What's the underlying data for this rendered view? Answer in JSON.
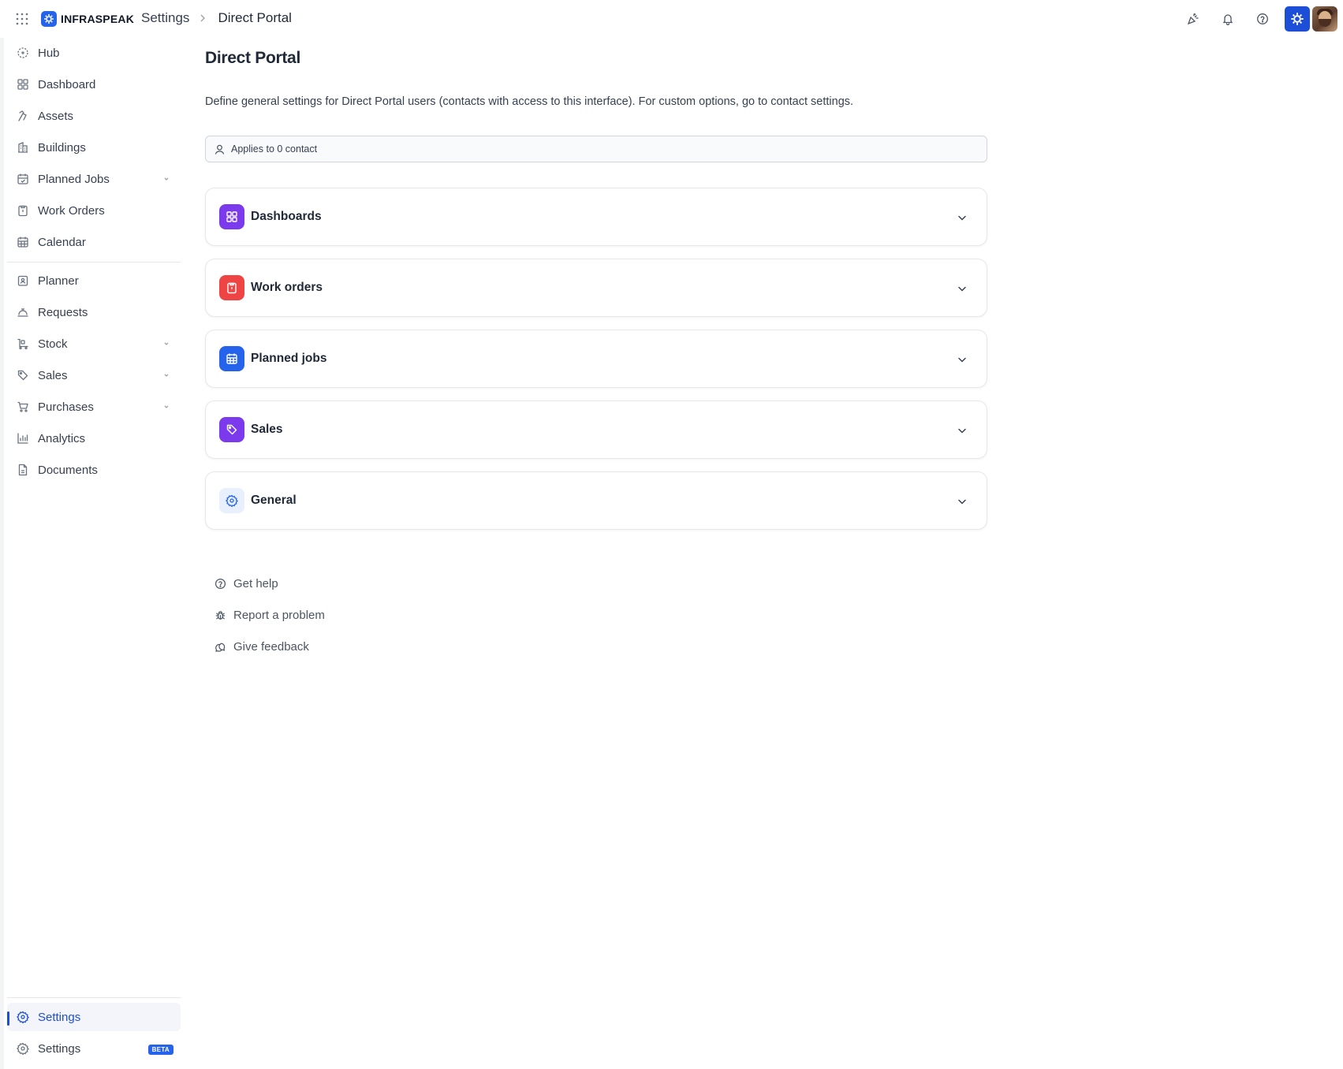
{
  "brand": {
    "name": "INFRASPEAK",
    "accent": "#2563eb"
  },
  "breadcrumb": {
    "parent": "Settings",
    "current": "Direct Portal"
  },
  "topbar": {
    "icons": [
      "apps-grid-icon",
      "celebrate-icon",
      "bell-icon",
      "help-circle-icon",
      "org-logo-icon",
      "avatar"
    ]
  },
  "sidebar": {
    "items": [
      {
        "label": "Hub",
        "icon": "hub-icon"
      },
      {
        "label": "Dashboard",
        "icon": "dashboard-icon"
      },
      {
        "label": "Assets",
        "icon": "assets-icon"
      },
      {
        "label": "Buildings",
        "icon": "buildings-icon"
      },
      {
        "label": "Planned Jobs",
        "icon": "calendar-check-icon",
        "expandable": true
      },
      {
        "label": "Work Orders",
        "icon": "clipboard-icon"
      },
      {
        "label": "Calendar",
        "icon": "calendar-icon"
      },
      {
        "label": "Planner",
        "icon": "planner-icon"
      },
      {
        "label": "Requests",
        "icon": "bell-service-icon"
      },
      {
        "label": "Stock",
        "icon": "stock-icon",
        "expandable": true
      },
      {
        "label": "Sales",
        "icon": "tag-icon",
        "expandable": true
      },
      {
        "label": "Purchases",
        "icon": "cart-icon",
        "expandable": true
      },
      {
        "label": "Analytics",
        "icon": "chart-icon"
      },
      {
        "label": "Documents",
        "icon": "document-icon"
      }
    ],
    "footer": [
      {
        "label": "Settings",
        "icon": "gear-icon",
        "active": true
      },
      {
        "label": "Settings",
        "icon": "gear-icon",
        "badge": "BETA"
      }
    ]
  },
  "main": {
    "title": "Direct Portal",
    "description": "Define general settings for Direct Portal users (contacts with access to this interface). For custom options, go to contact settings.",
    "applies_to": "Applies to 0 contact",
    "sections": [
      {
        "label": "Dashboards",
        "icon": "dashboard-icon",
        "color": "#7c3aed"
      },
      {
        "label": "Work orders",
        "icon": "clipboard-icon",
        "color": "#ef4444"
      },
      {
        "label": "Planned jobs",
        "icon": "calendar-icon",
        "color": "#2563eb"
      },
      {
        "label": "Sales",
        "icon": "tag-icon",
        "color": "#7c3aed"
      },
      {
        "label": "General",
        "icon": "gear-icon",
        "color": "#e8effd"
      }
    ],
    "help_links": [
      {
        "label": "Get help",
        "icon": "help-circle-icon"
      },
      {
        "label": "Report a problem",
        "icon": "bug-icon"
      },
      {
        "label": "Give feedback",
        "icon": "feedback-icon"
      }
    ]
  }
}
